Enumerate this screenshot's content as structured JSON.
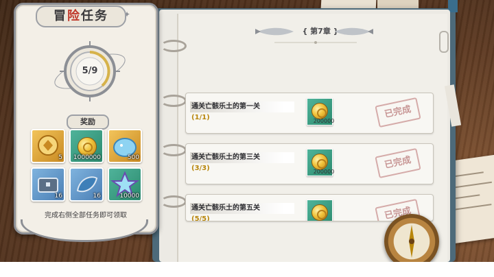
{
  "left_panel": {
    "title_prefix": "冒",
    "title_highlight": "险",
    "title_suffix": "任务",
    "progress_text": "5/9",
    "progress": {
      "done": 5,
      "total": 9
    },
    "reward_label": "奖励",
    "rewards": [
      {
        "icon": "golden-emblem-icon",
        "qty": "5",
        "style": "gold"
      },
      {
        "icon": "gold-coin-icon",
        "qty": "1000000",
        "style": "green"
      },
      {
        "icon": "blue-slime-icon",
        "qty": "500",
        "style": "gold"
      },
      {
        "icon": "blue-chest-icon",
        "qty": "16",
        "style": "blue"
      },
      {
        "icon": "blue-leaf-icon",
        "qty": "16",
        "style": "blue"
      },
      {
        "icon": "crystal-star-icon",
        "qty": "10000",
        "style": "green"
      }
    ],
    "note": "完成右侧全部任务即可领取"
  },
  "book": {
    "chapter": "第7章",
    "tasks": [
      {
        "name": "通关亡骸乐土的第一关",
        "progress": "(1/1)",
        "reward_qty": "200000",
        "status": "已完成"
      },
      {
        "name": "通关亡骸乐土的第三关",
        "progress": "(3/3)",
        "reward_qty": "200000",
        "status": "已完成"
      },
      {
        "name": "通关亡骸乐土的第五关",
        "progress": "(5/5)",
        "reward_qty": "",
        "status": "已完成"
      }
    ]
  },
  "colors": {
    "accent_red": "#c0392b",
    "progress_gold": "#b8860b",
    "book_cover": "#4d6a7a"
  }
}
